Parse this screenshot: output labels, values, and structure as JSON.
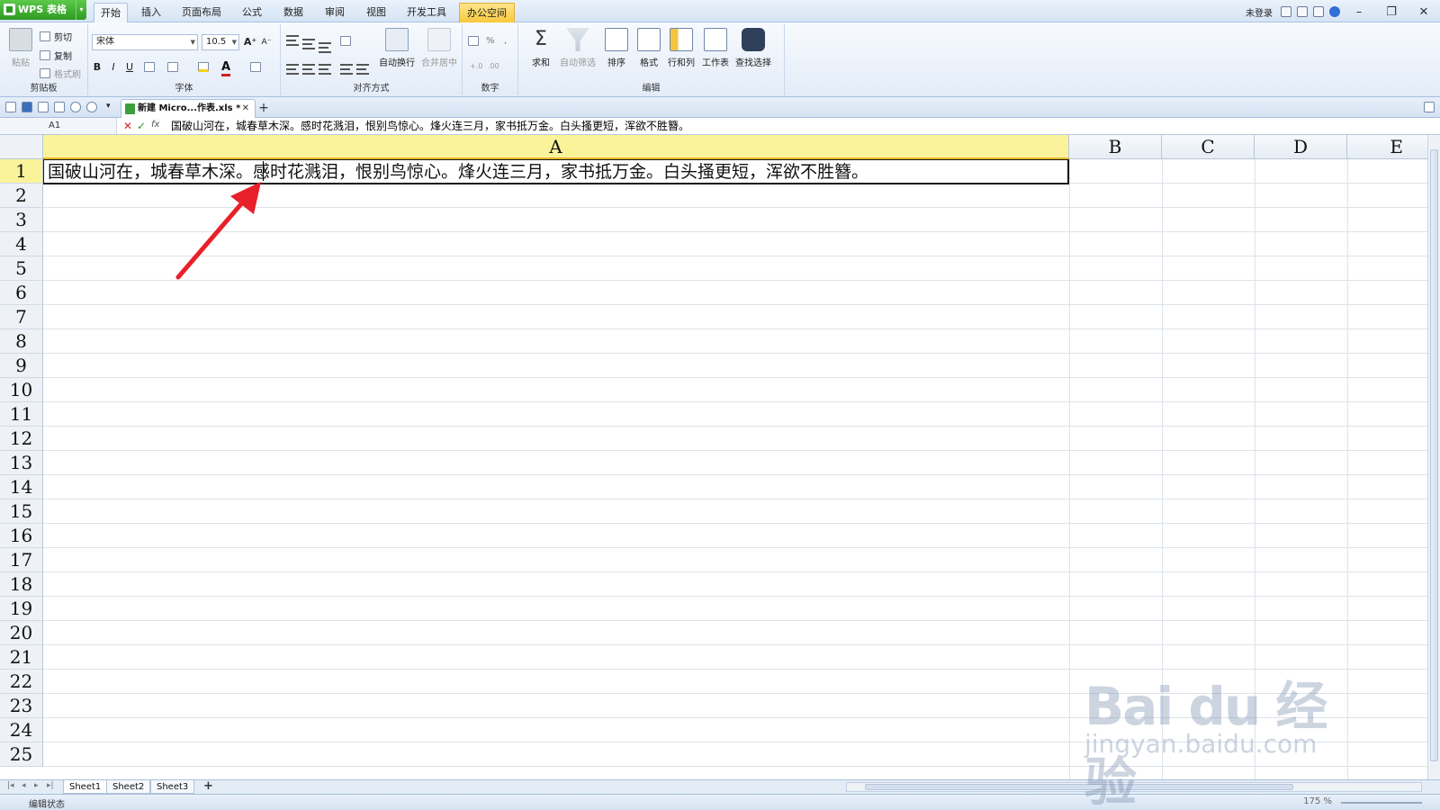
{
  "app": {
    "name": "WPS 表格",
    "menu_tabs": [
      "开始",
      "插入",
      "页面布局",
      "公式",
      "数据",
      "审阅",
      "视图",
      "开发工具",
      "办公空间"
    ],
    "active_tab": "开始",
    "login": "未登录"
  },
  "ribbon": {
    "clipboard": {
      "paste": "粘贴",
      "cut": "剪切",
      "copy": "复制",
      "format_painter": "格式刷",
      "group": "剪贴板"
    },
    "font": {
      "name": "宋体",
      "size": "10.5",
      "group": "字体",
      "bold": "B",
      "italic": "I",
      "underline": "U",
      "grow": "A⁺",
      "shrink": "A⁻"
    },
    "alignment": {
      "wrap": "自动换行",
      "merge": "合并居中",
      "group": "对齐方式"
    },
    "number": {
      "percent": "%",
      "comma": ",",
      "group": "数字"
    },
    "edit": {
      "sum": "求和",
      "filter": "自动筛选",
      "sort": "排序",
      "format": "格式",
      "rowcol": "行和列",
      "worksheet": "工作表",
      "find": "查找选择",
      "group": "编辑"
    }
  },
  "document": {
    "tab_title": "新建 Micro...作表.xls *"
  },
  "formula_bar": {
    "cell_ref": "A1",
    "content": "国破山河在，城春草木深。感时花溅泪，恨别鸟惊心。烽火连三月，家书抵万金。白头搔更短，浑欲不胜簪。"
  },
  "grid": {
    "columns": [
      "A",
      "B",
      "C",
      "D",
      "E"
    ],
    "rows": [
      "1",
      "2",
      "3",
      "4",
      "5",
      "6",
      "7",
      "8",
      "9",
      "10",
      "11",
      "12",
      "13",
      "14",
      "15",
      "16",
      "17",
      "18",
      "19",
      "20",
      "21",
      "22",
      "23",
      "24",
      "25"
    ],
    "cell_a1": "国破山河在，城春草木深。感时花溅泪，恨别鸟惊心。烽火连三月，家书抵万金。白头搔更短，浑欲不胜簪。"
  },
  "sheets": [
    "Sheet1",
    "Sheet2",
    "Sheet3"
  ],
  "status": {
    "mode": "编辑状态",
    "zoom": "175 %"
  },
  "watermark": {
    "brand": "Bai du 经验",
    "url": "jingyan.baidu.com"
  },
  "colors": {
    "accent_green": "#2e9a22",
    "selected_header": "#fbf39a",
    "annotation_arrow": "#e8202a"
  }
}
